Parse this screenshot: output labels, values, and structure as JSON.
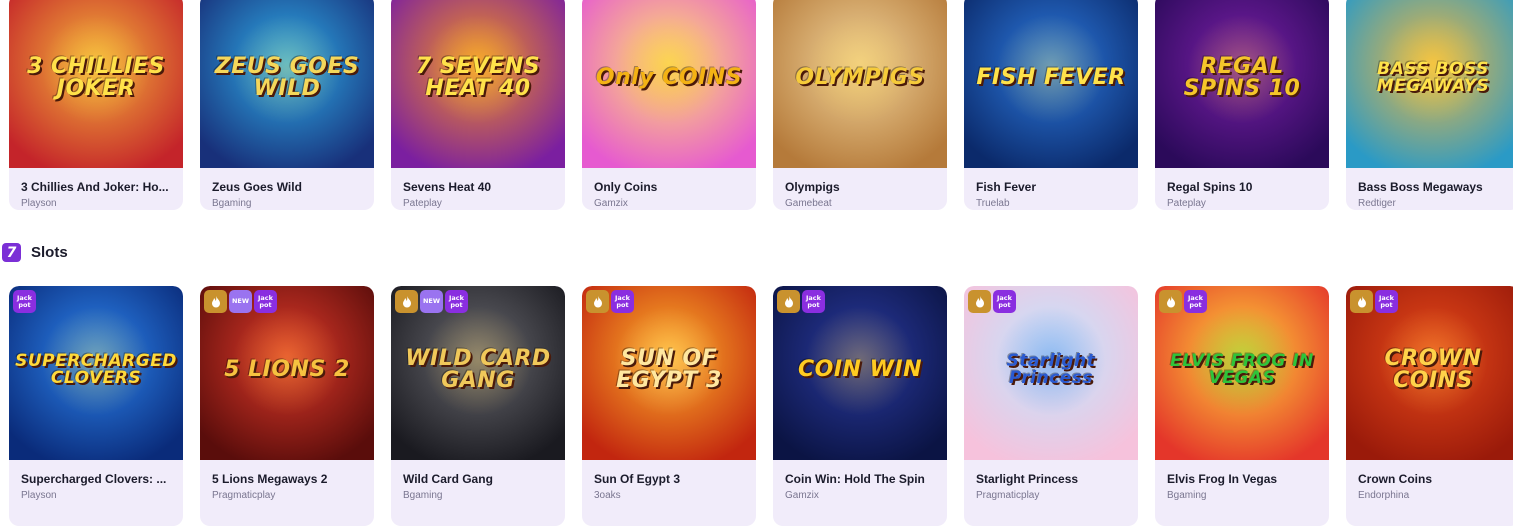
{
  "sections": [
    {
      "games": [
        {
          "title": "3 Chillies And Joker: Ho...",
          "provider": "Playson",
          "art": "3 CHILLIES JOKER",
          "bg": [
            "#f4b53a",
            "#c4242a"
          ],
          "ink": "#ffe14a"
        },
        {
          "title": "Zeus Goes Wild",
          "provider": "Bgaming",
          "art": "ZEUS GOES WILD",
          "bg": [
            "#2fb0ea",
            "#18307a"
          ],
          "ink": "#f5d75a"
        },
        {
          "title": "Sevens Heat 40",
          "provider": "Pateplay",
          "art": "7 SEVENS HEAT 40",
          "bg": [
            "#f39220",
            "#7b1fa0"
          ],
          "ink": "#ffe24a"
        },
        {
          "title": "Only Coins",
          "provider": "Gamzix",
          "art": "Only COINS",
          "bg": [
            "#ffe36b",
            "#e65ad0"
          ],
          "ink": "#f4b214"
        },
        {
          "title": "Olympigs",
          "provider": "Gamebeat",
          "art": "OLYMPIGS",
          "bg": [
            "#f1d49a",
            "#b57a3a"
          ],
          "ink": "#f6cb3a"
        },
        {
          "title": "Fish Fever",
          "provider": "Truelab",
          "art": "FISH FEVER",
          "bg": [
            "#2d7be0",
            "#0b2a6b"
          ],
          "ink": "#ffe24a"
        },
        {
          "title": "Regal Spins 10",
          "provider": "Pateplay",
          "art": "REGAL SPINS 10",
          "bg": [
            "#7b1fa8",
            "#2b0a5a"
          ],
          "ink": "#f5c52a"
        },
        {
          "title": "Bass Boss Megaways",
          "provider": "Redtiger",
          "art": "BASS BOSS MEGAWAYS",
          "bg": [
            "#f0b83e",
            "#2a9ac6"
          ],
          "ink": "#ffe24a"
        }
      ]
    },
    {
      "title": "Slots",
      "icon": "slots-seven-icon",
      "icon_glyph": "7",
      "games": [
        {
          "title": "Supercharged Clovers: ...",
          "provider": "Playson",
          "art": "SUPERCHARGED CLOVERS",
          "bg": [
            "#2d86f0",
            "#0a2b7a"
          ],
          "ink": "#ffd93a",
          "badges": [
            "jackpot"
          ]
        },
        {
          "title": "5 Lions Megaways 2",
          "provider": "Pragmaticplay",
          "art": "5 LIONS 2",
          "bg": [
            "#e23a2a",
            "#5a0d0b"
          ],
          "ink": "#f6c240",
          "badges": [
            "hot",
            "new",
            "jackpot"
          ]
        },
        {
          "title": "Wild Card Gang",
          "provider": "Bgaming",
          "art": "WILD CARD GANG",
          "bg": [
            "#6a6a70",
            "#1a1a20"
          ],
          "ink": "#f0c85a",
          "badges": [
            "hot",
            "new",
            "jackpot"
          ]
        },
        {
          "title": "Sun Of Egypt 3",
          "provider": "3oaks",
          "art": "SUN OF EGYPT 3",
          "bg": [
            "#ffb42a",
            "#c2260f"
          ],
          "ink": "#ffe7a0",
          "badges": [
            "hot",
            "jackpot"
          ]
        },
        {
          "title": "Coin Win: Hold The Spin",
          "provider": "Gamzix",
          "art": "COIN WIN",
          "bg": [
            "#2a3aa0",
            "#0b1444"
          ],
          "ink": "#ffcc22",
          "badges": [
            "hot",
            "jackpot"
          ]
        },
        {
          "title": "Starlight Princess",
          "provider": "Pragmaticplay",
          "art": "Starlight Princess",
          "bg": [
            "#bfe6ff",
            "#f6c2dc"
          ],
          "ink": "#2a5ad0",
          "badges": [
            "hot",
            "jackpot"
          ]
        },
        {
          "title": "Elvis Frog In Vegas",
          "provider": "Bgaming",
          "art": "ELVIS FROG IN VEGAS",
          "bg": [
            "#ffd43a",
            "#e4362a"
          ],
          "ink": "#2ec43a",
          "badges": [
            "hot",
            "jackpot"
          ]
        },
        {
          "title": "Crown Coins",
          "provider": "Endorphina",
          "art": "CROWN COINS",
          "bg": [
            "#e84a1a",
            "#9a1a0a"
          ],
          "ink": "#ffd24a",
          "badges": [
            "hot",
            "jackpot"
          ]
        }
      ]
    }
  ],
  "badge_labels": {
    "jackpot": "Jack pot",
    "new": "NEW"
  },
  "colors": {
    "card_bg": "#f1ecfa",
    "accent": "#7b2fd6",
    "title": "#1b1b2b",
    "provider": "#7a7690"
  }
}
